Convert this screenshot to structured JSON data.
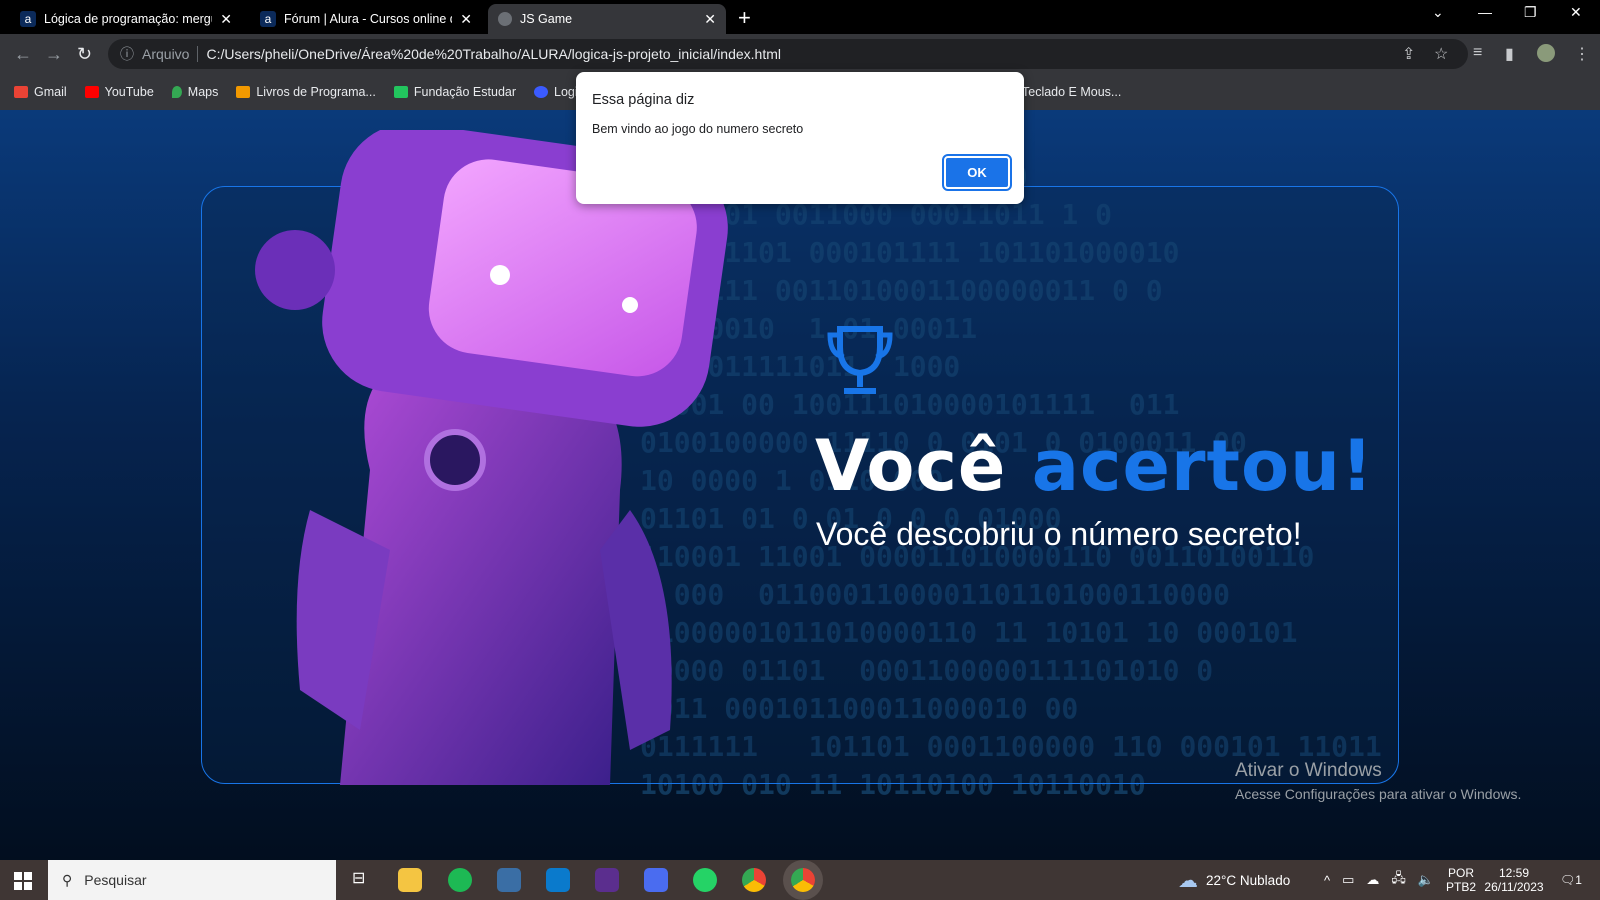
{
  "browser": {
    "tabs": [
      {
        "title": "Lógica de programação: mergulhe",
        "favicon": "a",
        "active": false
      },
      {
        "title": "Fórum | Alura - Cursos online de",
        "favicon": "a",
        "active": false
      },
      {
        "title": "JS Game",
        "favicon": "globe",
        "active": true
      }
    ],
    "new_tab": "+",
    "address": {
      "scheme": "Arquivo",
      "url": "C:/Users/pheli/OneDrive/Área%20de%20Trabalho/ALURA/logica-js-projeto_inicial/index.html"
    },
    "bookmarks": [
      {
        "label": "Gmail",
        "color": "#ea4335"
      },
      {
        "label": "YouTube",
        "color": "#ff0000"
      },
      {
        "label": "Maps",
        "color": "#34a853"
      },
      {
        "label": "Livros de Programa...",
        "color": "#f29900"
      },
      {
        "label": "Fundação Estudar",
        "color": "#22c55e"
      },
      {
        "label": "Logi",
        "color": "#3b5bff"
      },
      {
        "label": "Teclado E Mous...",
        "color": "#35363a"
      }
    ]
  },
  "page": {
    "binary_bg": "10 0110100101101100001\n000 01010010 1000000 10\n0110101 0011000 00011011 1 0\n000001101 000101111 101101000010\n0010111 0011010001100000011 0 0\n01000010  1 01 00011\n0001011111011  1000\n10001 00 100111010000101111  011\n0100100000 11110 0 0101 0 0100011 00\n10 0000 1 0110 000\n01101 01 0 01 0 0 0 01000\n110001 11001 000011010000110 00110100110\n0 000  0110001100001101101000110000\n11000001011010000110 11 10101 10 000101\n00000 01101  0001100000111101010 0\n0011 000101100011000010 00\n0111111   101101 0001100000 110 000101 11011\n10100 010 11 10110100 10110010",
    "heading_part1": "Você",
    "heading_part2": "acertou!",
    "subtitle": "Você descobriu o número secreto!",
    "accent_color": "#1875e8",
    "watermark": {
      "line1": "Ativar o Windows",
      "line2": "Acesse Configurações para ativar o Windows."
    }
  },
  "dialog": {
    "title": "Essa página diz",
    "message": "Bem vindo ao jogo do numero secreto",
    "ok": "OK"
  },
  "taskbar": {
    "search_placeholder": "Pesquisar",
    "weather": "22°C  Nublado",
    "lang1": "POR",
    "lang2": "PTB2",
    "time": "12:59",
    "date": "26/11/2023",
    "notifications": "1"
  }
}
